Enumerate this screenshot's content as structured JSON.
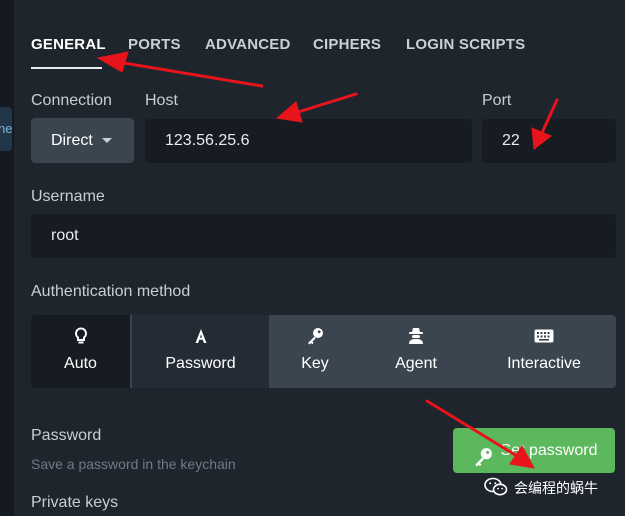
{
  "sidebar": {
    "partial_text": "ne"
  },
  "tabs": [
    {
      "label": "GENERAL",
      "active": true
    },
    {
      "label": "PORTS"
    },
    {
      "label": "ADVANCED"
    },
    {
      "label": "CIPHERS"
    },
    {
      "label": "LOGIN SCRIPTS"
    }
  ],
  "connection": {
    "label": "Connection",
    "value": "Direct"
  },
  "host": {
    "label": "Host",
    "value": "123.56.25.6"
  },
  "port": {
    "label": "Port",
    "value": "22"
  },
  "username": {
    "label": "Username",
    "value": "root"
  },
  "auth": {
    "label": "Authentication method",
    "options": [
      {
        "label": "Auto",
        "icon": "lightbulb-icon",
        "selected": true
      },
      {
        "label": "Password",
        "icon": "font-icon"
      },
      {
        "label": "Key",
        "icon": "key-icon"
      },
      {
        "label": "Agent",
        "icon": "user-secret-icon"
      },
      {
        "label": "Interactive",
        "icon": "keyboard-icon"
      }
    ]
  },
  "password": {
    "label": "Password",
    "hint": "Save a password in the keychain",
    "button": "Set password",
    "button_icon": "key-icon"
  },
  "private_keys": {
    "label": "Private keys"
  },
  "watermark": {
    "icon": "wechat-icon",
    "text": "会编程的蜗牛"
  },
  "colors": {
    "background": "#1e252d",
    "input_bg": "#161c22",
    "segment_bg": "#3a4550",
    "success": "#5cb85c",
    "annotation_arrow": "#e8141b"
  }
}
